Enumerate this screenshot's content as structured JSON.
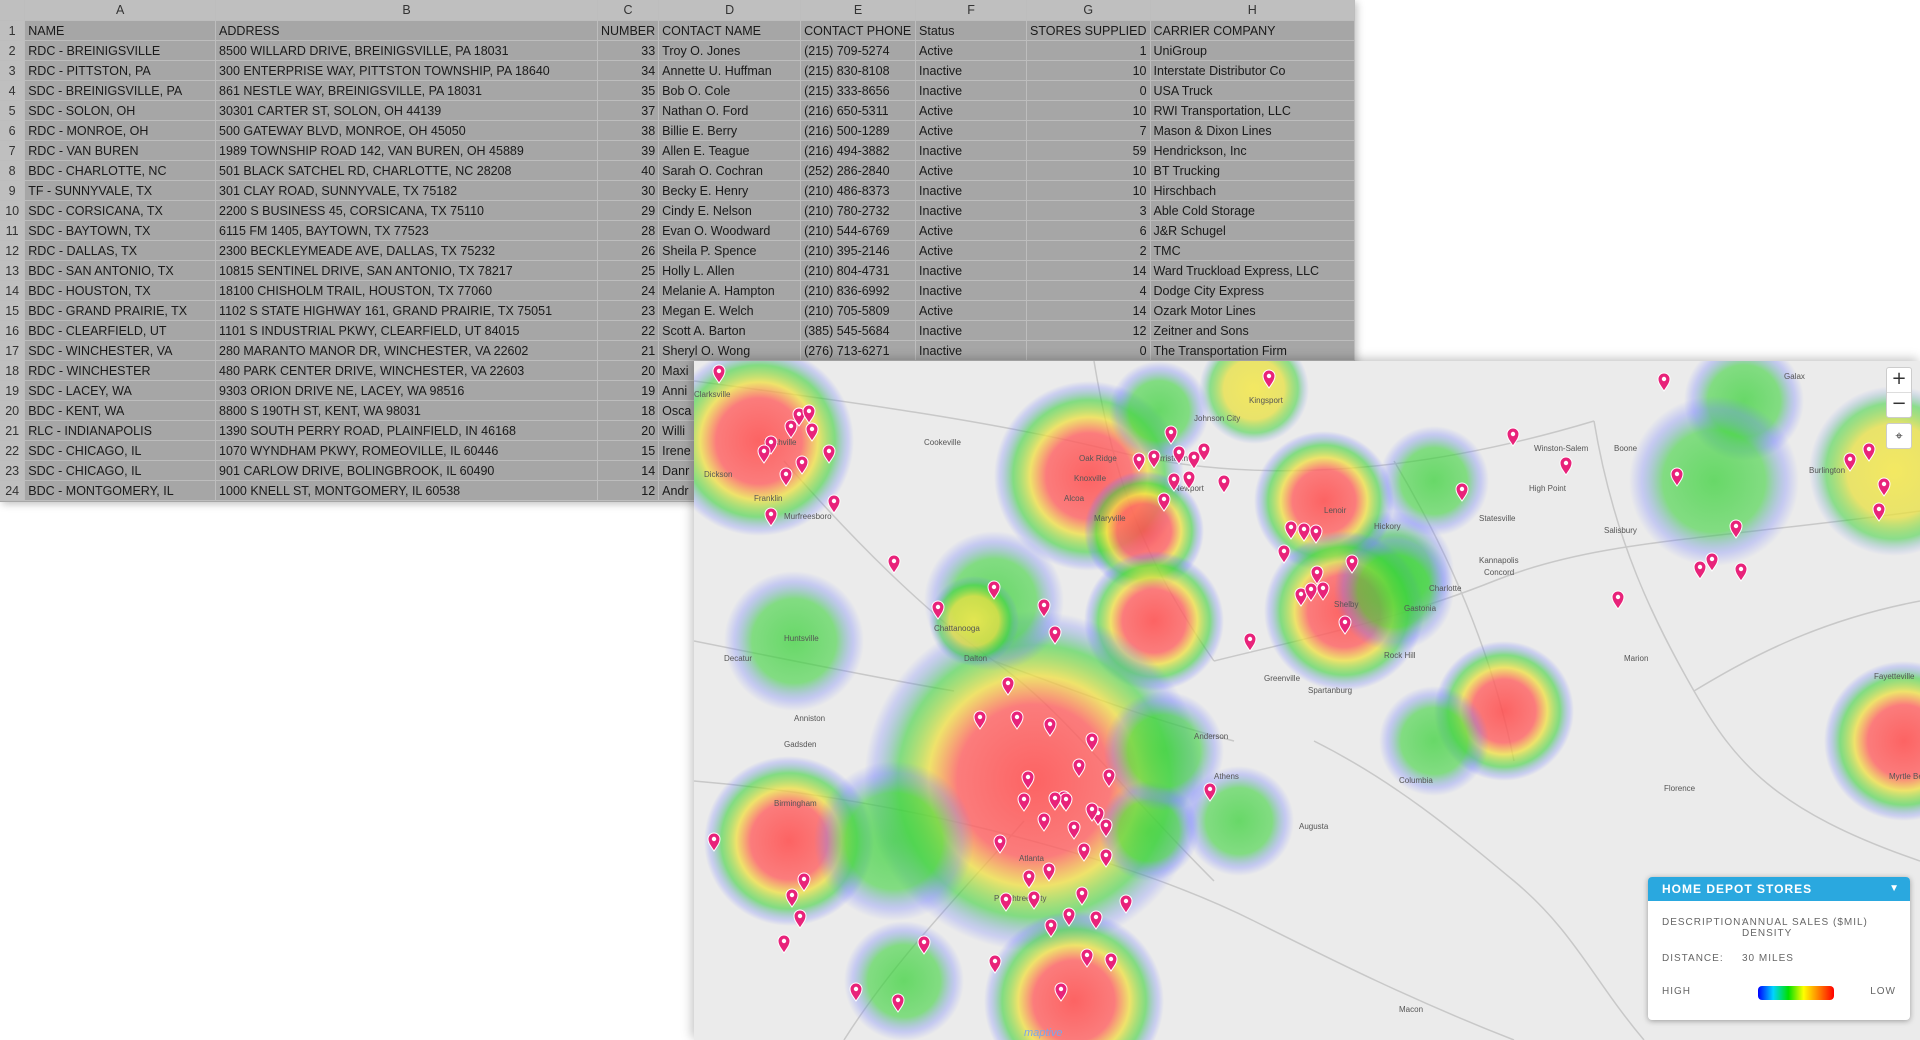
{
  "spreadsheet": {
    "column_letters": [
      "A",
      "B",
      "C",
      "D",
      "E",
      "F",
      "G",
      "H"
    ],
    "headers": [
      "NAME",
      "ADDRESS",
      "NUMBER",
      "CONTACT NAME",
      "CONTACT PHONE",
      "Status",
      "STORES SUPPLIED",
      "CARRIER COMPANY"
    ],
    "rows": [
      [
        "2",
        "RDC - BREINIGSVILLE",
        "8500 WILLARD DRIVE, BREINIGSVILLE, PA 18031",
        "33",
        "Troy O. Jones",
        "(215) 709-5274",
        "Active",
        "1",
        "UniGroup"
      ],
      [
        "3",
        "RDC - PITTSTON, PA",
        "300 ENTERPRISE WAY, PITTSTON TOWNSHIP, PA 18640",
        "34",
        "Annette U. Huffman",
        "(215) 830-8108",
        "Inactive",
        "10",
        "Interstate Distributor Co"
      ],
      [
        "4",
        "SDC - BREINIGSVILLE, PA",
        "861 NESTLE WAY, BREINIGSVILLE, PA 18031",
        "35",
        "Bob O. Cole",
        "(215) 333-8656",
        "Inactive",
        "0",
        "USA Truck"
      ],
      [
        "5",
        "SDC - SOLON, OH",
        "30301 CARTER ST, SOLON, OH 44139",
        "37",
        "Nathan O. Ford",
        "(216) 650-5311",
        "Active",
        "10",
        "RWI Transportation, LLC"
      ],
      [
        "6",
        "RDC - MONROE, OH",
        "500 GATEWAY BLVD, MONROE, OH 45050",
        "38",
        "Billie E. Berry",
        "(216) 500-1289",
        "Active",
        "7",
        "Mason & Dixon Lines"
      ],
      [
        "7",
        "RDC - VAN BUREN",
        "1989 TOWNSHIP ROAD 142, VAN BUREN, OH 45889",
        "39",
        "Allen E. Teague",
        "(216) 494-3882",
        "Inactive",
        "59",
        "Hendrickson, Inc"
      ],
      [
        "8",
        "BDC - CHARLOTTE, NC",
        "501 BLACK SATCHEL RD, CHARLOTTE, NC 28208",
        "40",
        "Sarah O. Cochran",
        "(252) 286-2840",
        "Active",
        "10",
        "BT Trucking"
      ],
      [
        "9",
        "TF - SUNNYVALE, TX",
        "301 CLAY ROAD, SUNNYVALE, TX 75182",
        "30",
        "Becky E. Henry",
        "(210) 486-8373",
        "Inactive",
        "10",
        "Hirschbach"
      ],
      [
        "10",
        "SDC - CORSICANA, TX",
        "2200 S BUSINESS 45, CORSICANA, TX 75110",
        "29",
        "Cindy E. Nelson",
        "(210) 780-2732",
        "Inactive",
        "3",
        "Able Cold Storage"
      ],
      [
        "11",
        "SDC - BAYTOWN, TX",
        "6115 FM 1405, BAYTOWN, TX 77523",
        "28",
        "Evan O. Woodward",
        "(210) 544-6769",
        "Active",
        "6",
        "J&R Schugel"
      ],
      [
        "12",
        "RDC - DALLAS, TX",
        "2300 BECKLEYMEADE AVE, DALLAS, TX 75232",
        "26",
        "Sheila P. Spence",
        "(210) 395-2146",
        "Active",
        "2",
        "TMC"
      ],
      [
        "13",
        "BDC - SAN ANTONIO, TX",
        "10815 SENTINEL DRIVE, SAN ANTONIO, TX 78217",
        "25",
        "Holly L. Allen",
        "(210) 804-4731",
        "Inactive",
        "14",
        "Ward Truckload Express, LLC"
      ],
      [
        "14",
        "BDC - HOUSTON, TX",
        "18100 CHISHOLM TRAIL, HOUSTON, TX 77060",
        "24",
        "Melanie A. Hampton",
        "(210) 836-6992",
        "Inactive",
        "4",
        "Dodge City Express"
      ],
      [
        "15",
        "BDC - GRAND PRAIRIE, TX",
        "1102 S STATE HIGHWAY 161, GRAND PRAIRIE, TX 75051",
        "23",
        "Megan E. Welch",
        "(210) 705-5809",
        "Active",
        "14",
        "Ozark Motor Lines"
      ],
      [
        "16",
        "BDC - CLEARFIELD, UT",
        "1101 S INDUSTRIAL PKWY, CLEARFIELD, UT 84015",
        "22",
        "Scott A. Barton",
        "(385) 545-5684",
        "Inactive",
        "12",
        "Zeitner and Sons"
      ],
      [
        "17",
        "SDC - WINCHESTER, VA",
        "280 MARANTO MANOR DR, WINCHESTER, VA 22602",
        "21",
        "Sheryl O. Wong",
        "(276) 713-6271",
        "Inactive",
        "0",
        "The Transportation Firm"
      ],
      [
        "18",
        "RDC - WINCHESTER",
        "480 PARK CENTER DRIVE, WINCHESTER, VA 22603",
        "20",
        "Maxi",
        "",
        "",
        "",
        ""
      ],
      [
        "19",
        "SDC - LACEY, WA",
        "9303 ORION DRIVE NE, LACEY, WA 98516",
        "19",
        "Anni",
        "",
        "",
        "",
        ""
      ],
      [
        "20",
        "BDC - KENT, WA",
        "8800 S 190TH ST, KENT, WA 98031",
        "18",
        "Osca",
        "",
        "",
        "",
        ""
      ],
      [
        "21",
        "RLC - INDIANAPOLIS",
        "1390 SOUTH PERRY ROAD, PLAINFIELD, IN 46168",
        "20",
        "Willi",
        "",
        "",
        "",
        ""
      ],
      [
        "22",
        "SDC - CHICAGO, IL",
        "1070 WYNDHAM PKWY, ROMEOVILLE, IL 60446",
        "15",
        "Irene",
        "",
        "",
        "",
        ""
      ],
      [
        "23",
        "SDC - CHICAGO, IL",
        "901 CARLOW DRIVE, BOLINGBROOK, IL 60490",
        "14",
        "Danr",
        "",
        "",
        "",
        ""
      ],
      [
        "24",
        "BDC - MONTGOMERY, IL",
        "1000 KNELL ST, MONTGOMERY, IL 60538",
        "12",
        "Andr",
        "",
        "",
        "",
        ""
      ]
    ]
  },
  "map": {
    "city_labels": [
      "Nashville",
      "Franklin",
      "Murfreesboro",
      "Knoxville",
      "Huntsville",
      "Chattanooga",
      "Dalton",
      "Atlanta",
      "Birmingham",
      "Greenville",
      "Charlotte",
      "Columbia",
      "Augusta",
      "Athens",
      "Anderson",
      "Kingsport",
      "Winston-Salem",
      "High Point",
      "Spartanburg",
      "Gastonia",
      "Morristown",
      "Cookeville",
      "Alcoa",
      "Peachtree City",
      "Newport",
      "Hickory",
      "Statesville",
      "Kannapolis",
      "Concord",
      "Rock Hill",
      "Maryville",
      "Oak Ridge",
      "Clarksville",
      "Decatur",
      "Anniston",
      "Gadsden",
      "Florence",
      "Burlington",
      "Salisbury",
      "Macon",
      "Fayetteville",
      "Galax",
      "Boone",
      "Shelby",
      "Lenoir",
      "Myrtle Beach",
      "Dickson",
      "Johnson City",
      "Marion"
    ],
    "attribution": "maptive",
    "zoom_in": "+",
    "zoom_out": "−",
    "locate_icon": "⌖",
    "heat_colors": {
      "low": "#3c50ff",
      "mid": "#3cd23c",
      "high": "#ff4b4b"
    },
    "pin_color": "#e8237a"
  },
  "legend": {
    "title": "HOME DEPOT STORES",
    "caret": "▼",
    "description_label": "DESCRIPTION:",
    "description_value": "ANNUAL SALES ($MIL) DENSITY",
    "distance_label": "DISTANCE:",
    "distance_value": "30 MILES",
    "high_label": "HIGH",
    "low_label": "LOW"
  }
}
